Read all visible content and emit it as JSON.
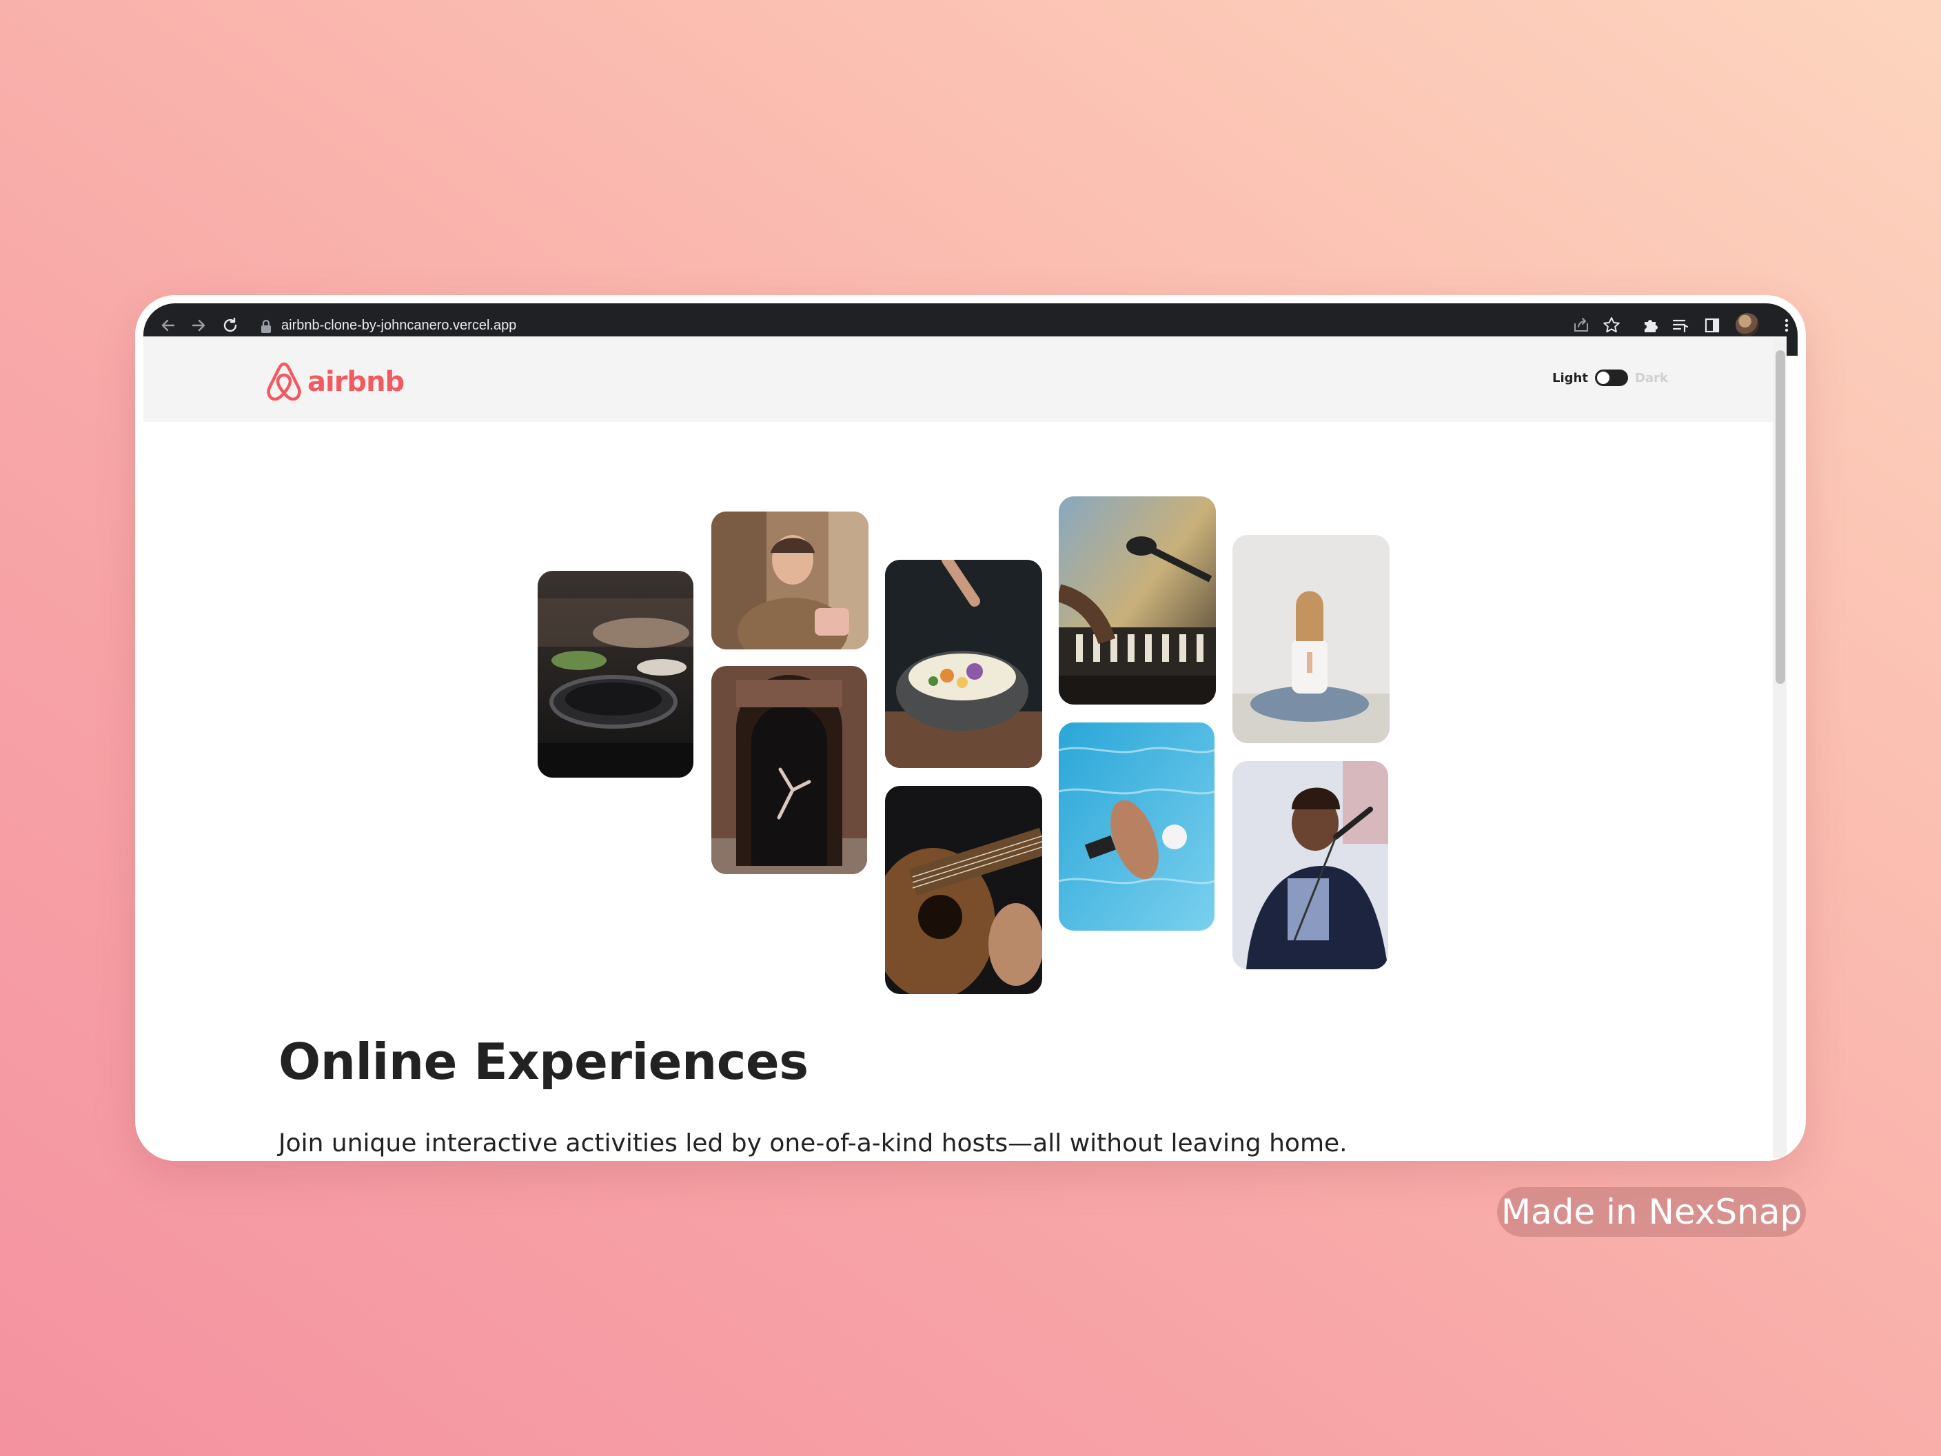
{
  "browser": {
    "url": "airbnb-clone-by-johncanero.vercel.app",
    "icons": [
      "back-arrow-icon",
      "forward-arrow-icon",
      "reload-icon",
      "lock-icon",
      "share-icon",
      "star-icon",
      "puzzle-icon",
      "media-queue-icon",
      "side-panel-icon",
      "profile-avatar",
      "menu-kebab-icon"
    ]
  },
  "header": {
    "logo_text": "airbnb",
    "brand_color": "#f35a5f",
    "toggle_light": "Light",
    "toggle_dark": "Dark"
  },
  "gallery": {
    "photos": [
      {
        "name": "photo-cooking-pan"
      },
      {
        "name": "photo-woman-kitchen"
      },
      {
        "name": "photo-dancer-doorway"
      },
      {
        "name": "photo-plating-bowl"
      },
      {
        "name": "photo-guitar"
      },
      {
        "name": "photo-keyboard-microphone"
      },
      {
        "name": "photo-swimmer"
      },
      {
        "name": "photo-yoga"
      },
      {
        "name": "photo-singer"
      }
    ]
  },
  "hero": {
    "title": "Online Experiences",
    "subtitle": "Join unique interactive activities led by one-of-a-kind hosts—all without leaving home."
  },
  "watermark": {
    "text": "Made in NexSnap"
  }
}
